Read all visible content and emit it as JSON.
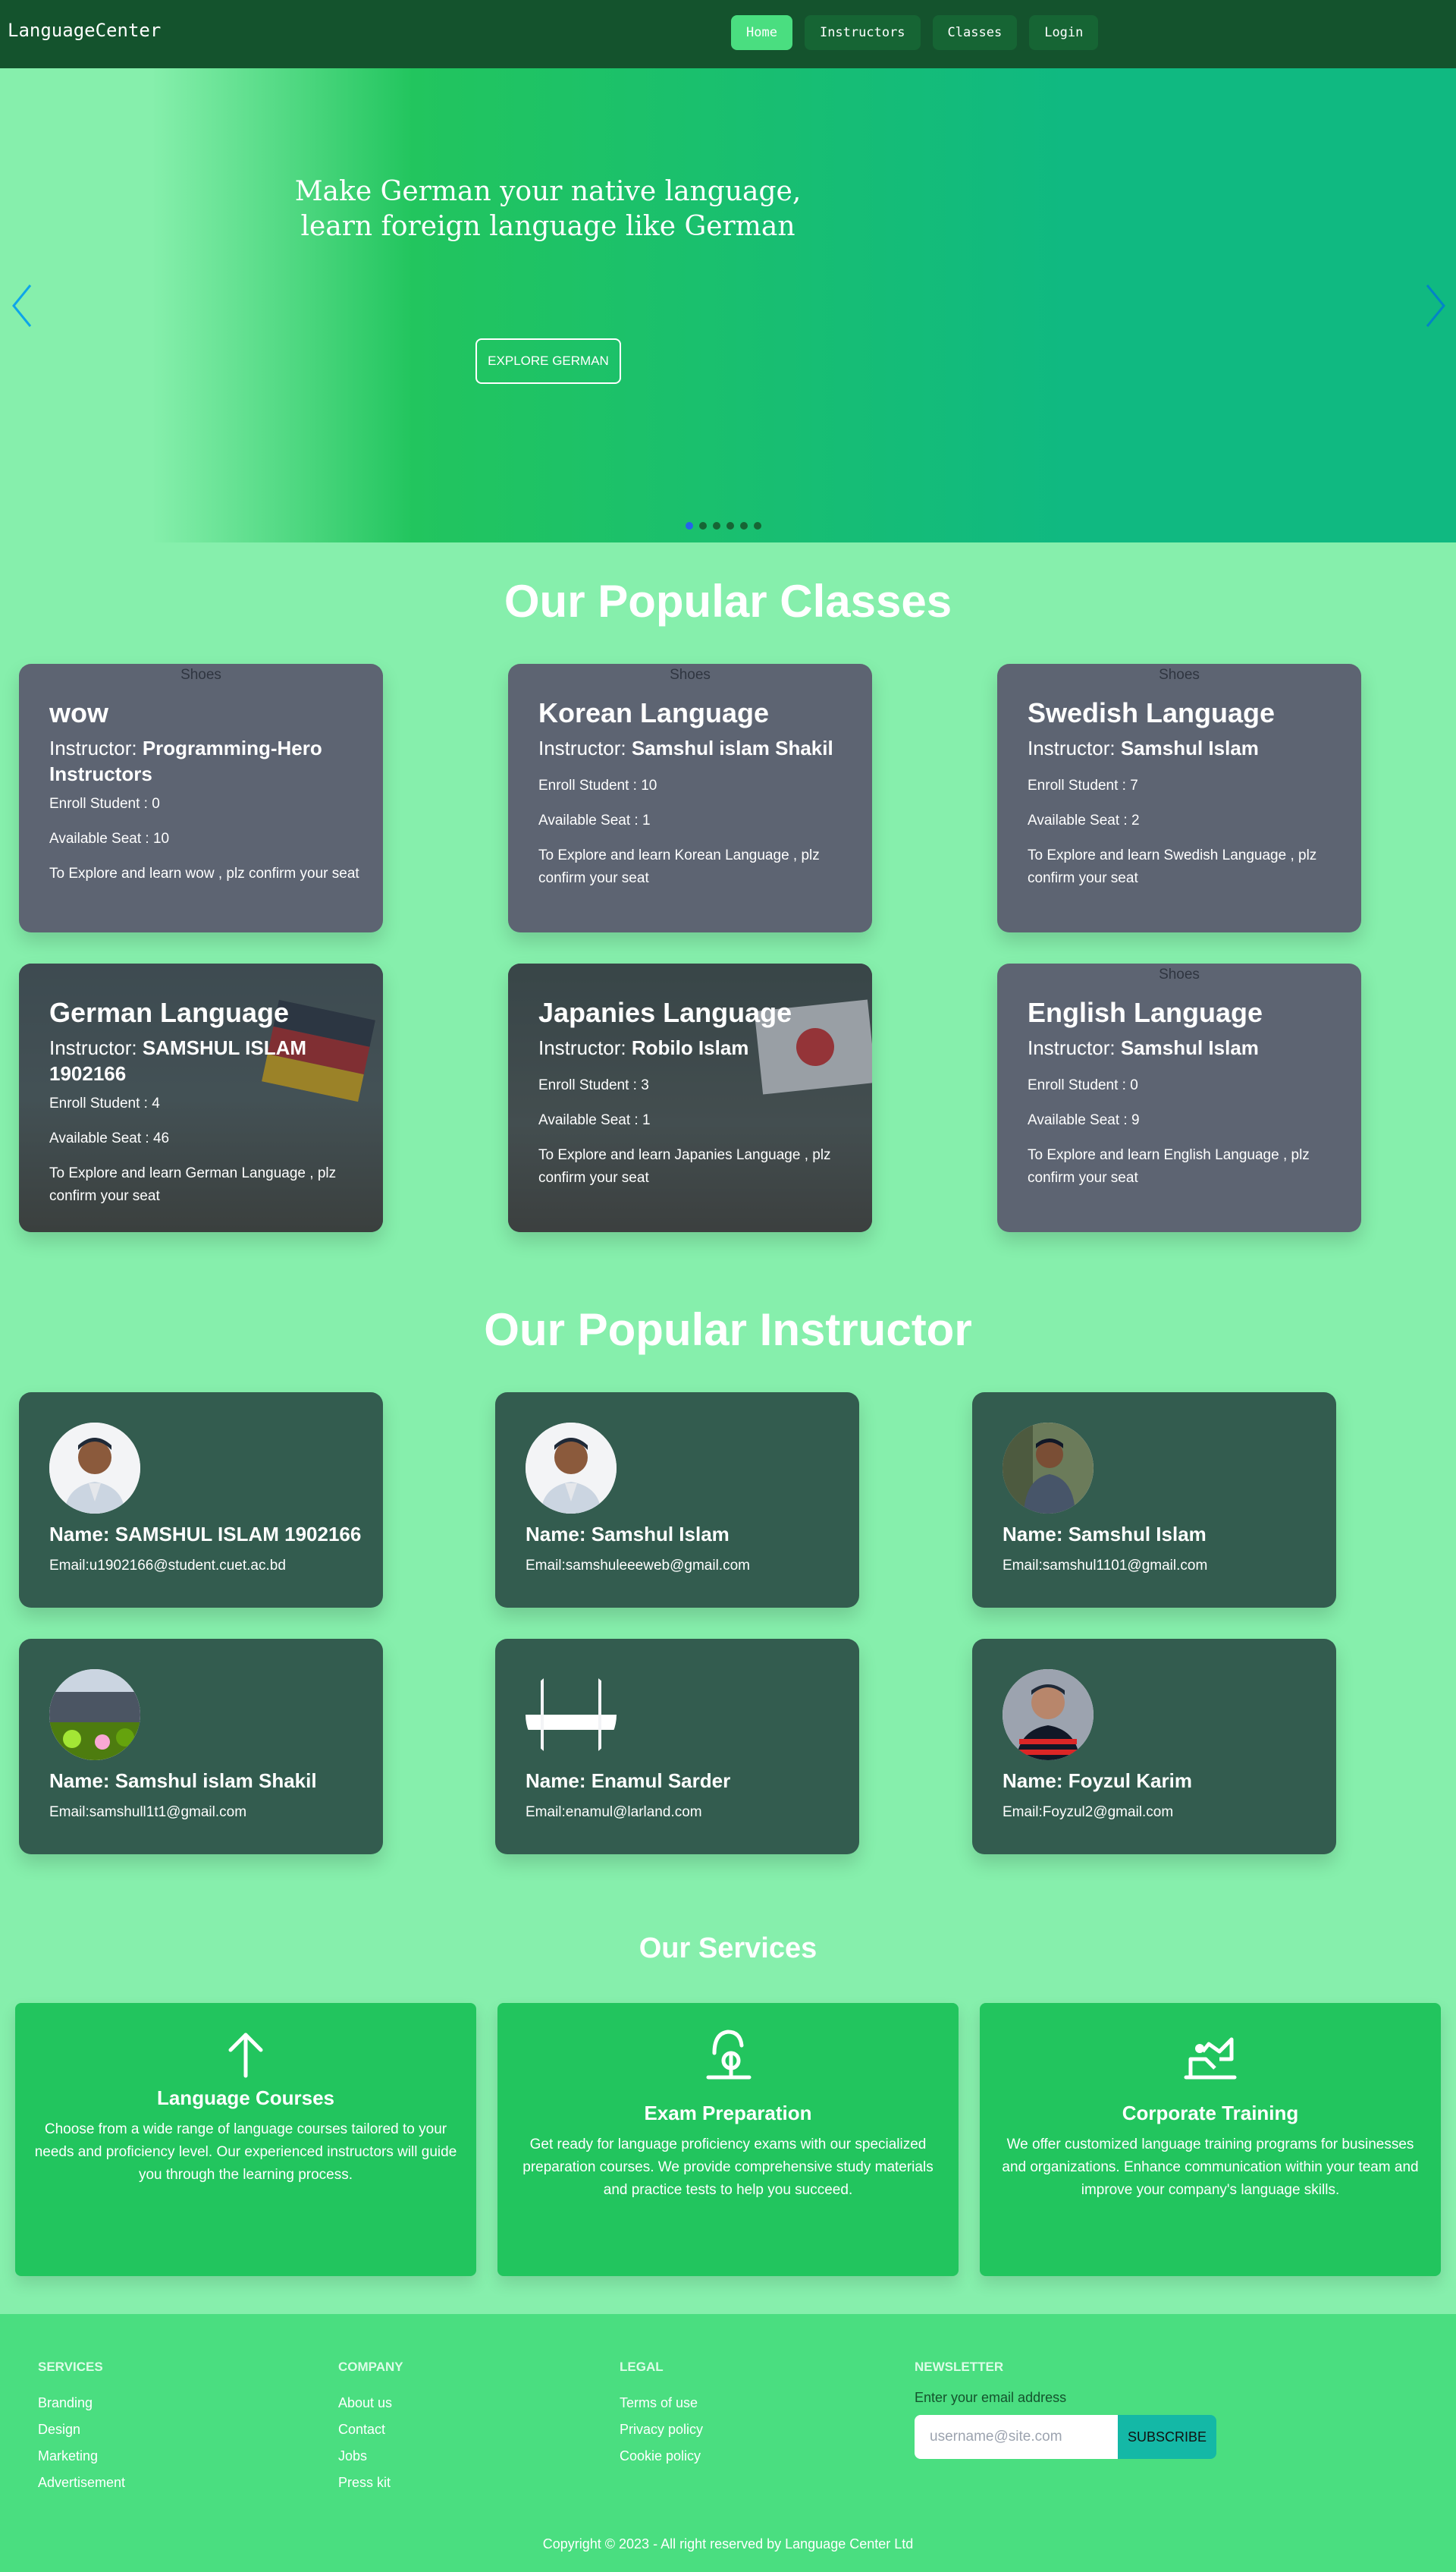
{
  "navbar": {
    "brand": "LanguageCenter",
    "items": [
      {
        "label": "Home",
        "active": true
      },
      {
        "label": "Instructors",
        "active": false
      },
      {
        "label": "Classes",
        "active": false
      },
      {
        "label": "Login",
        "active": false
      }
    ]
  },
  "hero": {
    "headline_line1": "Make German your native language,",
    "headline_line2": "learn foreign language like German",
    "cta_label": "EXPLORE GERMAN",
    "slide_count": 6,
    "active_slide": 1
  },
  "popular_classes": {
    "title": "Our Popular Classes",
    "image_alt": "Shoes",
    "instructor_prefix": "Instructor: ",
    "enroll_prefix": "Enroll Student : ",
    "seat_prefix": "Available Seat : ",
    "cards": [
      {
        "name": "wow",
        "instructor": "Programming-Hero Instructors",
        "enroll": "0",
        "seats": "10",
        "desc": "To Explore and learn wow , plz confirm your seat"
      },
      {
        "name": "Korean Language",
        "instructor": "Samshul islam Shakil",
        "enroll": "10",
        "seats": "1",
        "desc": "To Explore and learn Korean Language , plz confirm your seat"
      },
      {
        "name": "Swedish Language",
        "instructor": "Samshul Islam",
        "enroll": "7",
        "seats": "2",
        "desc": "To Explore and learn Swedish Language , plz confirm your seat"
      },
      {
        "name": "German Language",
        "instructor": "SAMSHUL ISLAM 1902166",
        "enroll": "4",
        "seats": "46",
        "desc": "To Explore and learn German Language , plz confirm your seat"
      },
      {
        "name": "Japanies Language",
        "instructor": "Robilo Islam",
        "enroll": "3",
        "seats": "1",
        "desc": "To Explore and learn Japanies Language , plz confirm your seat"
      },
      {
        "name": "English Language",
        "instructor": "Samshul Islam",
        "enroll": "0",
        "seats": "9",
        "desc": "To Explore and learn English Language , plz confirm your seat"
      }
    ]
  },
  "popular_instructors": {
    "title": "Our Popular Instructor",
    "name_prefix": "Name: ",
    "email_prefix": "Email:",
    "cards": [
      {
        "name": "SAMSHUL ISLAM 1902166",
        "email": "u1902166@student.cuet.ac.bd"
      },
      {
        "name": "Samshul Islam",
        "email": "samshuleeeweb@gmail.com"
      },
      {
        "name": "Samshul Islam",
        "email": "samshul1101@gmail.com"
      },
      {
        "name": "Samshul islam Shakil",
        "email": "samshull1t1@gmail.com"
      },
      {
        "name": "Enamul Sarder",
        "email": "enamul@larland.com"
      },
      {
        "name": "Foyzul Karim",
        "email": "Foyzul2@gmail.com"
      }
    ]
  },
  "services": {
    "title": "Our Services",
    "cards": [
      {
        "icon": "arrow-up-icon",
        "title": "Language Courses",
        "text": "Choose from a wide range of language courses tailored to your needs and proficiency level. Our experienced instructors will guide you through the learning process."
      },
      {
        "icon": "exam-icon",
        "title": "Exam Preparation",
        "text": "Get ready for language proficiency exams with our specialized preparation courses. We provide comprehensive study materials and practice tests to help you succeed."
      },
      {
        "icon": "training-icon",
        "title": "Corporate Training",
        "text": "We offer customized language training programs for businesses and organizations. Enhance communication within your team and improve your company's language skills."
      }
    ]
  },
  "footer": {
    "services": {
      "title": "SERVICES",
      "links": [
        "Branding",
        "Design",
        "Marketing",
        "Advertisement"
      ]
    },
    "company": {
      "title": "COMPANY",
      "links": [
        "About us",
        "Contact",
        "Jobs",
        "Press kit"
      ]
    },
    "legal": {
      "title": "LEGAL",
      "links": [
        "Terms of use",
        "Privacy policy",
        "Cookie policy"
      ]
    },
    "newsletter": {
      "title": "NEWSLETTER",
      "label": "Enter your email address",
      "placeholder": "username@site.com",
      "button": "SUBSCRIBE"
    },
    "copyright": "Copyright © 2023 - All right reserved by Language Center Ltd"
  },
  "colors": {
    "page_bg": "#86efac",
    "navbar_bg": "#14532d",
    "nav_active": "#4ade80",
    "class_card_bg": "#5d6472",
    "instructor_card_bg": "#335c4f",
    "service_card_bg": "#22c55e",
    "footer_bg": "#4ade80",
    "subscribe_bg": "#14b8a6"
  }
}
